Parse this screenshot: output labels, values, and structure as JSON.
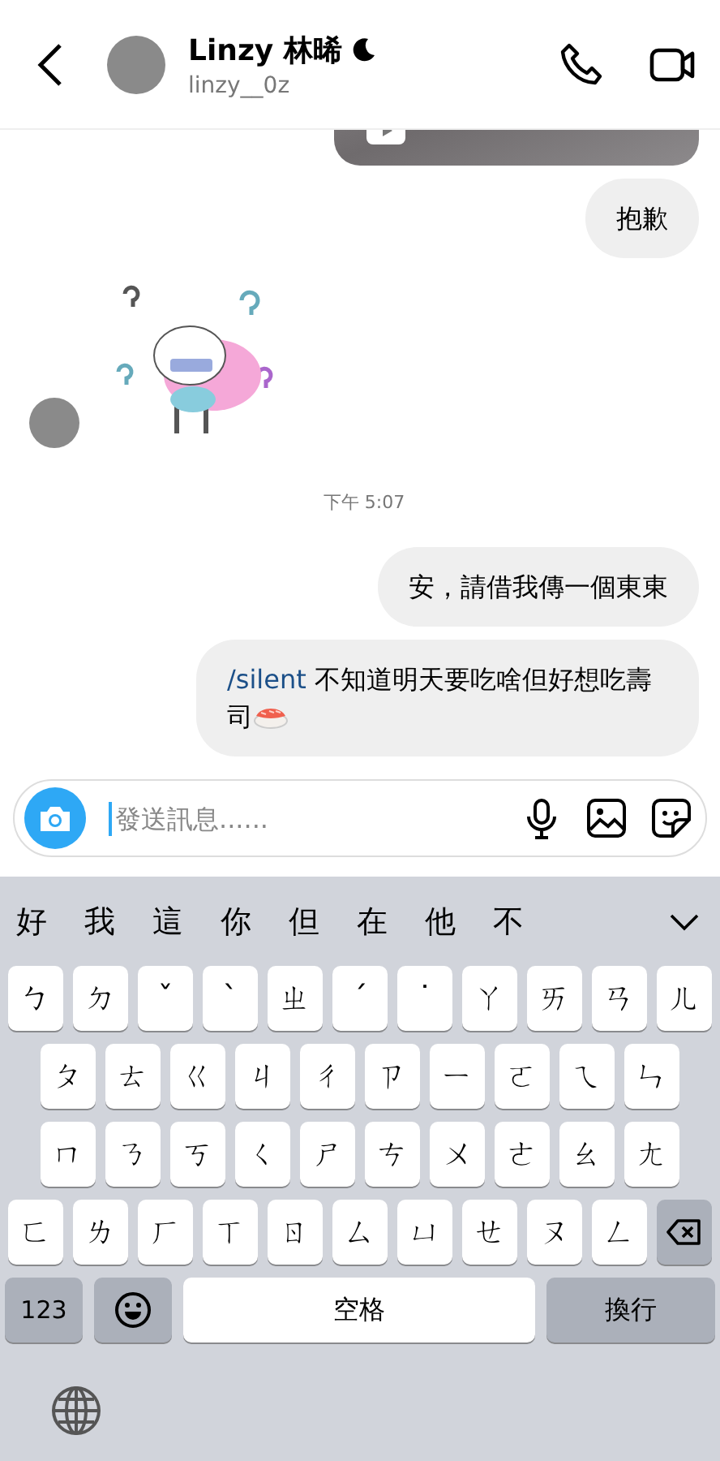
{
  "header": {
    "name": "Linzy 林晞",
    "username": "linzy__0z"
  },
  "messages": [
    {
      "kind": "video",
      "outgoing": true
    },
    {
      "kind": "text",
      "outgoing": true,
      "text": "抱歉"
    },
    {
      "kind": "sticker",
      "outgoing": false
    },
    {
      "kind": "time",
      "text": "下午 5:07"
    },
    {
      "kind": "text",
      "outgoing": true,
      "text": "安，請借我傳一個東東"
    },
    {
      "kind": "command",
      "outgoing": true,
      "command": "/silent",
      "text": "不知道明天要吃啥但好想吃壽司"
    }
  ],
  "composer": {
    "placeholder": "發送訊息......"
  },
  "keyboard": {
    "candidates": [
      "好",
      "我",
      "這",
      "你",
      "但",
      "在",
      "他",
      "不"
    ],
    "rows": [
      [
        "ㄅ",
        "ㄉ",
        "ˇ",
        "ˋ",
        "ㄓ",
        "ˊ",
        "˙",
        "ㄚ",
        "ㄞ",
        "ㄢ",
        "ㄦ"
      ],
      [
        "ㄆ",
        "ㄊ",
        "ㄍ",
        "ㄐ",
        "ㄔ",
        "ㄗ",
        "ㄧ",
        "ㄛ",
        "ㄟ",
        "ㄣ"
      ],
      [
        "ㄇ",
        "ㄋ",
        "ㄎ",
        "ㄑ",
        "ㄕ",
        "ㄘ",
        "ㄨ",
        "ㄜ",
        "ㄠ",
        "ㄤ"
      ],
      [
        "ㄈ",
        "ㄌ",
        "ㄏ",
        "ㄒ",
        "ㄖ",
        "ㄙ",
        "ㄩ",
        "ㄝ",
        "ㄡ",
        "ㄥ"
      ]
    ],
    "numbers_key": "123",
    "space_key": "空格",
    "return_key": "換行"
  }
}
